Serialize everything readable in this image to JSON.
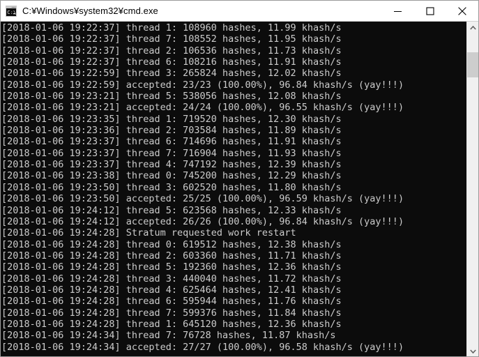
{
  "window": {
    "title": "C:¥Windows¥system32¥cmd.exe",
    "icon": "cmd-console-icon",
    "colors": {
      "titlebar_bg": "#ffffff",
      "console_bg": "#0c0c0c",
      "console_fg": "#cccccc",
      "border": "#9a9a9a",
      "scrollbar_track": "#f0f0f0",
      "scrollbar_thumb": "#cdcdcd"
    },
    "controls": {
      "minimize": "—",
      "maximize": "□",
      "close": "✕",
      "minimize_name": "minimize-button",
      "maximize_name": "maximize-button",
      "close_name": "close-button"
    }
  },
  "scrollbar": {
    "up_arrow": "˄",
    "down_arrow": "˅",
    "thumb_position_pct": 6,
    "thumb_size_pct": 8
  },
  "console": {
    "lines": [
      "[2018-01-06 19:22:37] thread 1: 108960 hashes, 11.99 khash/s",
      "[2018-01-06 19:22:37] thread 7: 108552 hashes, 11.95 khash/s",
      "[2018-01-06 19:22:37] thread 2: 106536 hashes, 11.73 khash/s",
      "[2018-01-06 19:22:37] thread 6: 108216 hashes, 11.91 khash/s",
      "[2018-01-06 19:22:59] thread 3: 265824 hashes, 12.02 khash/s",
      "[2018-01-06 19:22:59] accepted: 23/23 (100.00%), 96.84 khash/s (yay!!!)",
      "[2018-01-06 19:23:21] thread 5: 538056 hashes, 12.08 khash/s",
      "[2018-01-06 19:23:21] accepted: 24/24 (100.00%), 96.55 khash/s (yay!!!)",
      "[2018-01-06 19:23:35] thread 1: 719520 hashes, 12.30 khash/s",
      "[2018-01-06 19:23:36] thread 2: 703584 hashes, 11.89 khash/s",
      "[2018-01-06 19:23:37] thread 6: 714696 hashes, 11.91 khash/s",
      "[2018-01-06 19:23:37] thread 7: 716904 hashes, 11.93 khash/s",
      "[2018-01-06 19:23:37] thread 4: 747192 hashes, 12.39 khash/s",
      "[2018-01-06 19:23:38] thread 0: 745200 hashes, 12.29 khash/s",
      "[2018-01-06 19:23:50] thread 3: 602520 hashes, 11.80 khash/s",
      "[2018-01-06 19:23:50] accepted: 25/25 (100.00%), 96.59 khash/s (yay!!!)",
      "[2018-01-06 19:24:12] thread 5: 623568 hashes, 12.33 khash/s",
      "[2018-01-06 19:24:12] accepted: 26/26 (100.00%), 96.84 khash/s (yay!!!)",
      "[2018-01-06 19:24:28] Stratum requested work restart",
      "[2018-01-06 19:24:28] thread 0: 619512 hashes, 12.38 khash/s",
      "[2018-01-06 19:24:28] thread 2: 603360 hashes, 11.71 khash/s",
      "[2018-01-06 19:24:28] thread 5: 192360 hashes, 12.36 khash/s",
      "[2018-01-06 19:24:28] thread 3: 440040 hashes, 11.72 khash/s",
      "[2018-01-06 19:24:28] thread 4: 625464 hashes, 12.41 khash/s",
      "[2018-01-06 19:24:28] thread 6: 595944 hashes, 11.76 khash/s",
      "[2018-01-06 19:24:28] thread 7: 599376 hashes, 11.84 khash/s",
      "[2018-01-06 19:24:28] thread 1: 645120 hashes, 12.36 khash/s",
      "[2018-01-06 19:24:34] thread 7: 76728 hashes, 11.87 khash/s",
      "[2018-01-06 19:24:34] accepted: 27/27 (100.00%), 96.58 khash/s (yay!!!)"
    ]
  }
}
